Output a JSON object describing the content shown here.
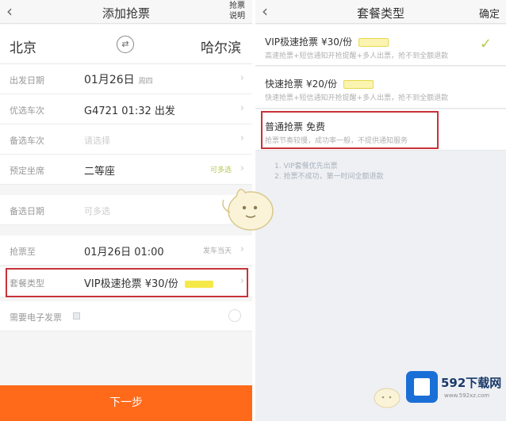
{
  "left": {
    "header": {
      "back_icon": "chevron-left-icon",
      "title": "添加抢票",
      "help": "抢票说明"
    },
    "from_city": "北京",
    "to_city": "哈尔滨",
    "swap_icon": "swap-icon",
    "rows": {
      "depart_date": {
        "label": "出发日期",
        "value": "01月26日",
        "weekday": "周四"
      },
      "preferred_train": {
        "label": "优选车次",
        "value": "G4721   01:32 出发"
      },
      "backup_train": {
        "label": "备选车次",
        "placeholder": "请选择"
      },
      "seat": {
        "label": "预定坐席",
        "value": "二等座",
        "note": "可多选"
      },
      "backup_date": {
        "label": "备选日期",
        "placeholder": "可多选"
      },
      "grab_until": {
        "label": "抢票至",
        "value": "01月26日 01:00",
        "note": "发车当天"
      },
      "package": {
        "label": "套餐类型",
        "value": "VIP极速抢票 ¥30/份"
      },
      "invoice": {
        "label": "需要电子发票"
      }
    },
    "next_button": "下一步"
  },
  "right": {
    "header": {
      "back_icon": "chevron-left-icon",
      "title": "套餐类型",
      "confirm": "确定"
    },
    "packages": [
      {
        "name": "VIP极速抢票",
        "price": "¥30/份",
        "desc": "高速抢票+短信通知开抢提醒+多人出票，抢不到全额退款",
        "selected": true
      },
      {
        "name": "快速抢票",
        "price": "¥20/份",
        "desc": "快速抢票+短信通知开抢提醒+多人出票，抢不到全额退款",
        "selected": false
      },
      {
        "name": "普通抢票",
        "price": "免费",
        "desc": "抢票节奏较慢，成功率一般，不提供通知服务",
        "selected": false
      }
    ],
    "notes": [
      "1. VIP套餐优先出票",
      "2. 抢票不成功，第一时间全额退款"
    ]
  },
  "watermark": {
    "brand": "592下载网",
    "site": "www.592xz.com"
  },
  "colors": {
    "accent": "#ff6a1a",
    "highlight_box": "#c8323a",
    "badge": "#f5e94a",
    "check": "#b5cc4a",
    "logo": "#1a6fd6"
  }
}
